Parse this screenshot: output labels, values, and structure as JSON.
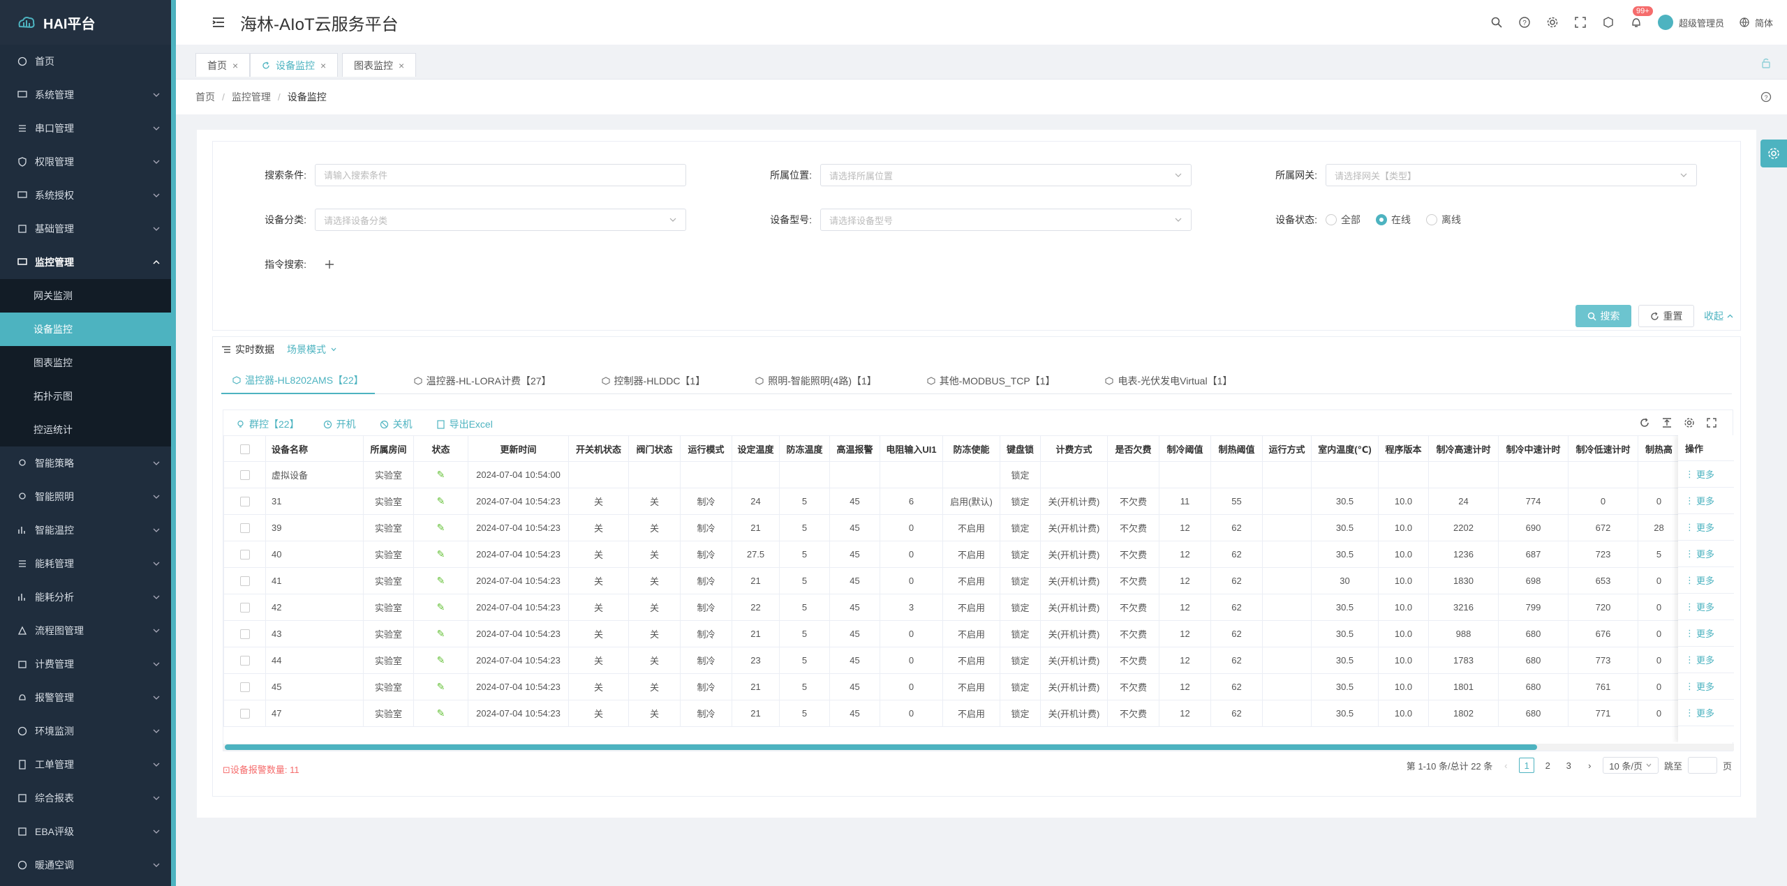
{
  "app": {
    "logo": "HAI平台",
    "title": "海林-AIoT云服务平台"
  },
  "header": {
    "badge": "99+",
    "user": "超级管理员",
    "lang": "简体"
  },
  "sidebar": {
    "items": [
      {
        "label": "首页"
      },
      {
        "label": "系统管理"
      },
      {
        "label": "串口管理"
      },
      {
        "label": "权限管理"
      },
      {
        "label": "系统授权"
      },
      {
        "label": "基础管理"
      },
      {
        "label": "监控管理"
      },
      {
        "label": "智能策略"
      },
      {
        "label": "智能照明"
      },
      {
        "label": "智能温控"
      },
      {
        "label": "能耗管理"
      },
      {
        "label": "能耗分析"
      },
      {
        "label": "流程图管理"
      },
      {
        "label": "计费管理"
      },
      {
        "label": "报警管理"
      },
      {
        "label": "环境监测"
      },
      {
        "label": "工单管理"
      },
      {
        "label": "综合报表"
      },
      {
        "label": "EBA评级"
      },
      {
        "label": "暖通空调"
      }
    ],
    "sub": [
      {
        "label": "网关监测"
      },
      {
        "label": "设备监控"
      },
      {
        "label": "图表监控"
      },
      {
        "label": "拓扑示图"
      },
      {
        "label": "控运统计"
      }
    ]
  },
  "tabs": [
    {
      "label": "首页"
    },
    {
      "label": "设备监控"
    },
    {
      "label": "图表监控"
    }
  ],
  "breadcrumb": {
    "l1": "首页",
    "l2": "监控管理",
    "l3": "设备监控"
  },
  "search": {
    "cond_label": "搜索条件:",
    "cond_ph": "请输入搜索条件",
    "loc_label": "所属位置:",
    "loc_ph": "请选择所属位置",
    "gw_label": "所属网关:",
    "gw_ph": "请选择网关【类型】",
    "cat_label": "设备分类:",
    "cat_ph": "请选择设备分类",
    "model_label": "设备型号:",
    "model_ph": "请选择设备型号",
    "status_label": "设备状态:",
    "radios": [
      {
        "label": "全部"
      },
      {
        "label": "在线"
      },
      {
        "label": "离线"
      }
    ],
    "selected_status": "在线",
    "cmd_label": "指令搜索:",
    "search_btn": "搜索",
    "reset_btn": "重置",
    "collapse": "收起"
  },
  "realtime": {
    "title": "实时数据",
    "scene": "场景模式"
  },
  "device_tabs": [
    {
      "label": "温控器-HL8202AMS【22】"
    },
    {
      "label": "温控器-HL-LORA计费【27】"
    },
    {
      "label": "控制器-HLDDC【1】"
    },
    {
      "label": "照明-智能照明(4路)【1】"
    },
    {
      "label": "其他-MODBUS_TCP【1】"
    },
    {
      "label": "电表-光伏发电Virtual【1】"
    }
  ],
  "ops": {
    "group": "群控【22】",
    "on": "开机",
    "off": "关机",
    "export": "导出Excel"
  },
  "table": {
    "headers": [
      "设备名称",
      "所属房间",
      "状态",
      "更新时间",
      "开关机状态",
      "阀门状态",
      "运行模式",
      "设定温度",
      "防冻温度",
      "高温报警",
      "电阻输入UI1",
      "防冻使能",
      "键盘锁",
      "计费方式",
      "是否欠费",
      "制冷阈值",
      "制热阈值",
      "运行方式",
      "室内温度(℃)",
      "程序版本",
      "制冷高速计时",
      "制冷中速计时",
      "制冷低速计时",
      "制热高"
    ],
    "op_header": "操作",
    "more": "更多",
    "rows": [
      [
        "虚拟设备",
        "实验室",
        "✎",
        "2024-07-04 10:54:00",
        "",
        "",
        "",
        "",
        "",
        "",
        "",
        "",
        "锁定",
        "",
        "",
        "",
        "",
        "",
        "",
        "",
        "",
        "",
        "",
        ""
      ],
      [
        "31",
        "实验室",
        "✎",
        "2024-07-04 10:54:23",
        "关",
        "关",
        "制冷",
        "24",
        "5",
        "45",
        "6",
        "启用(默认)",
        "锁定",
        "关(开机计费)",
        "不欠费",
        "11",
        "55",
        "",
        "30.5",
        "10.0",
        "24",
        "774",
        "0",
        "0"
      ],
      [
        "39",
        "实验室",
        "✎",
        "2024-07-04 10:54:23",
        "关",
        "关",
        "制冷",
        "21",
        "5",
        "45",
        "0",
        "不启用",
        "锁定",
        "关(开机计费)",
        "不欠费",
        "12",
        "62",
        "",
        "30.5",
        "10.0",
        "2202",
        "690",
        "672",
        "28"
      ],
      [
        "40",
        "实验室",
        "✎",
        "2024-07-04 10:54:23",
        "关",
        "关",
        "制冷",
        "27.5",
        "5",
        "45",
        "0",
        "不启用",
        "锁定",
        "关(开机计费)",
        "不欠费",
        "12",
        "62",
        "",
        "30.5",
        "10.0",
        "1236",
        "687",
        "723",
        "5"
      ],
      [
        "41",
        "实验室",
        "✎",
        "2024-07-04 10:54:23",
        "关",
        "关",
        "制冷",
        "21",
        "5",
        "45",
        "0",
        "不启用",
        "锁定",
        "关(开机计费)",
        "不欠费",
        "12",
        "62",
        "",
        "30",
        "10.0",
        "1830",
        "698",
        "653",
        "0"
      ],
      [
        "42",
        "实验室",
        "✎",
        "2024-07-04 10:54:23",
        "关",
        "关",
        "制冷",
        "22",
        "5",
        "45",
        "3",
        "不启用",
        "锁定",
        "关(开机计费)",
        "不欠费",
        "12",
        "62",
        "",
        "30.5",
        "10.0",
        "3216",
        "799",
        "720",
        "0"
      ],
      [
        "43",
        "实验室",
        "✎",
        "2024-07-04 10:54:23",
        "关",
        "关",
        "制冷",
        "21",
        "5",
        "45",
        "0",
        "不启用",
        "锁定",
        "关(开机计费)",
        "不欠费",
        "12",
        "62",
        "",
        "30.5",
        "10.0",
        "988",
        "680",
        "676",
        "0"
      ],
      [
        "44",
        "实验室",
        "✎",
        "2024-07-04 10:54:23",
        "关",
        "关",
        "制冷",
        "23",
        "5",
        "45",
        "0",
        "不启用",
        "锁定",
        "关(开机计费)",
        "不欠费",
        "12",
        "62",
        "",
        "30.5",
        "10.0",
        "1783",
        "680",
        "773",
        "0"
      ],
      [
        "45",
        "实验室",
        "✎",
        "2024-07-04 10:54:23",
        "关",
        "关",
        "制冷",
        "21",
        "5",
        "45",
        "0",
        "不启用",
        "锁定",
        "关(开机计费)",
        "不欠费",
        "12",
        "62",
        "",
        "30.5",
        "10.0",
        "1801",
        "680",
        "761",
        "0"
      ],
      [
        "47",
        "实验室",
        "✎",
        "2024-07-04 10:54:23",
        "关",
        "关",
        "制冷",
        "21",
        "5",
        "45",
        "0",
        "不启用",
        "锁定",
        "关(开机计费)",
        "不欠费",
        "12",
        "62",
        "",
        "30.5",
        "10.0",
        "1802",
        "680",
        "771",
        "0"
      ]
    ]
  },
  "footer": {
    "alarm_label": "设备报警数量:",
    "alarm_count": "11",
    "summary": "第 1-10 条/总计 22 条",
    "pages": [
      "1",
      "2",
      "3"
    ],
    "page_size": "10 条/页",
    "jump_label": "跳至",
    "page_unit": "页"
  },
  "colors": {
    "accent": "#4db3c0",
    "sidebar": "#1f2d3d",
    "danger": "#f56c6c"
  }
}
